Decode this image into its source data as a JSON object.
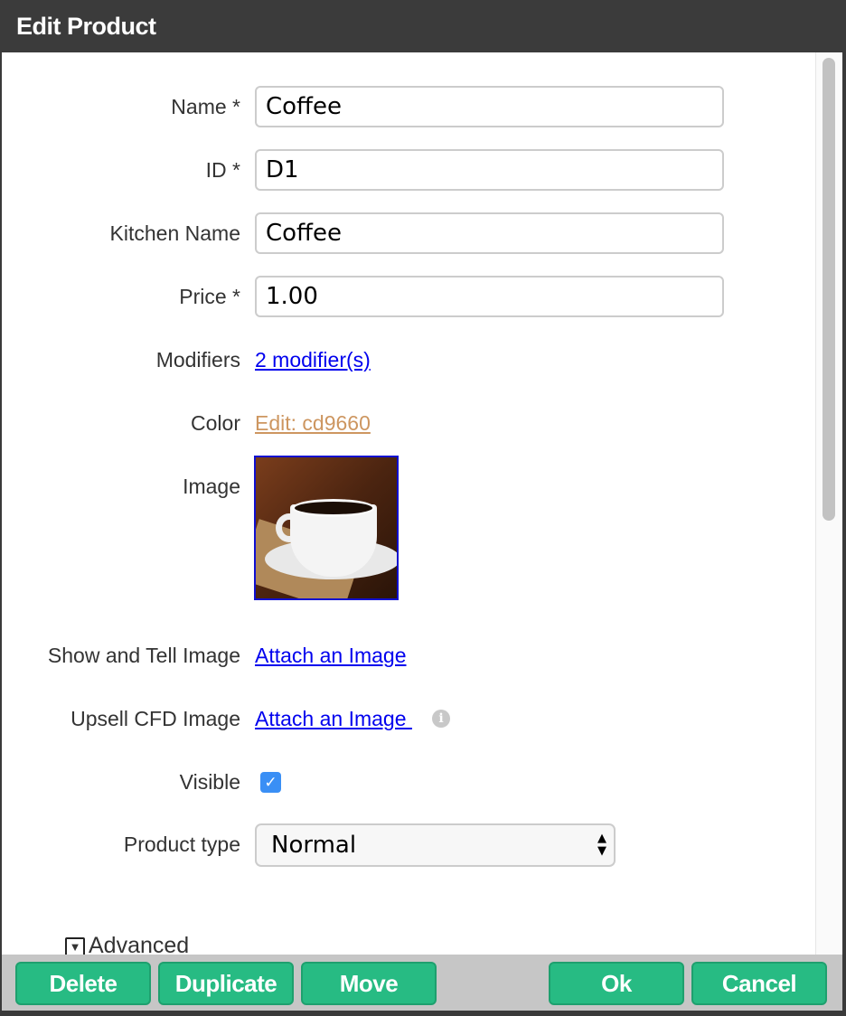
{
  "dialog": {
    "title": "Edit Product"
  },
  "form": {
    "name": {
      "label": "Name *",
      "value": "Coffee"
    },
    "id": {
      "label": "ID *",
      "value": "D1"
    },
    "kitchen_name": {
      "label": "Kitchen Name",
      "value": "Coffee"
    },
    "price": {
      "label": "Price *",
      "value": "1.00"
    },
    "modifiers": {
      "label": "Modifiers",
      "link": "2 modifier(s)"
    },
    "color": {
      "label": "Color",
      "link": "Edit: cd9660",
      "color": "#cd9660"
    },
    "image": {
      "label": "Image"
    },
    "show_tell": {
      "label": "Show and Tell Image",
      "link": "Attach an Image"
    },
    "upsell": {
      "label": "Upsell CFD Image",
      "link": "Attach an Image ",
      "info_icon": "info-icon"
    },
    "visible": {
      "label": "Visible",
      "checked": true
    },
    "product_type": {
      "label": "Product type",
      "value": "Normal"
    },
    "advanced": {
      "label": "Advanced"
    }
  },
  "footer": {
    "delete": "Delete",
    "duplicate": "Duplicate",
    "move": "Move",
    "ok": "Ok",
    "cancel": "Cancel",
    "button_color": "#27bb83"
  }
}
